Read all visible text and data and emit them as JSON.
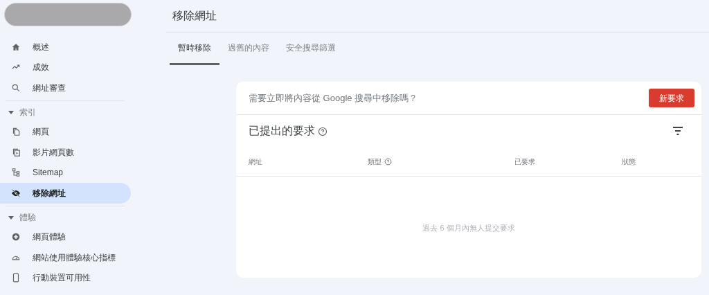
{
  "sidebar": {
    "groups": [
      {
        "items": [
          {
            "label": "概述",
            "selected": false
          },
          {
            "label": "成效",
            "selected": false
          },
          {
            "label": "網址審查",
            "selected": false
          }
        ]
      },
      {
        "header": "索引",
        "expanded": true,
        "items": [
          {
            "label": "網頁",
            "selected": false
          },
          {
            "label": "影片網頁數",
            "selected": false
          },
          {
            "label": "Sitemap",
            "selected": false
          },
          {
            "label": "移除網址",
            "selected": true
          }
        ]
      },
      {
        "header": "體驗",
        "expanded": true,
        "items": [
          {
            "label": "網頁體驗",
            "selected": false
          },
          {
            "label": "網站使用體驗核心指標",
            "selected": false
          },
          {
            "label": "行動裝置可用性",
            "selected": false
          }
        ]
      }
    ]
  },
  "page_title": "移除網址",
  "tabs": [
    {
      "label": "暫時移除",
      "selected": true
    },
    {
      "label": "過舊的內容",
      "selected": false
    },
    {
      "label": "安全搜尋篩選",
      "selected": false
    }
  ],
  "card": {
    "prompt": "需要立即將內容從 Google 搜尋中移除嗎？",
    "button": "新要求",
    "heading": "已提出的要求",
    "columns": [
      {
        "label": "網址",
        "help": false
      },
      {
        "label": "類型",
        "help": true
      },
      {
        "label": "已要求",
        "help": false
      },
      {
        "label": "狀態",
        "help": false
      }
    ],
    "empty_message": "過去 6 個月內無人提交要求"
  }
}
